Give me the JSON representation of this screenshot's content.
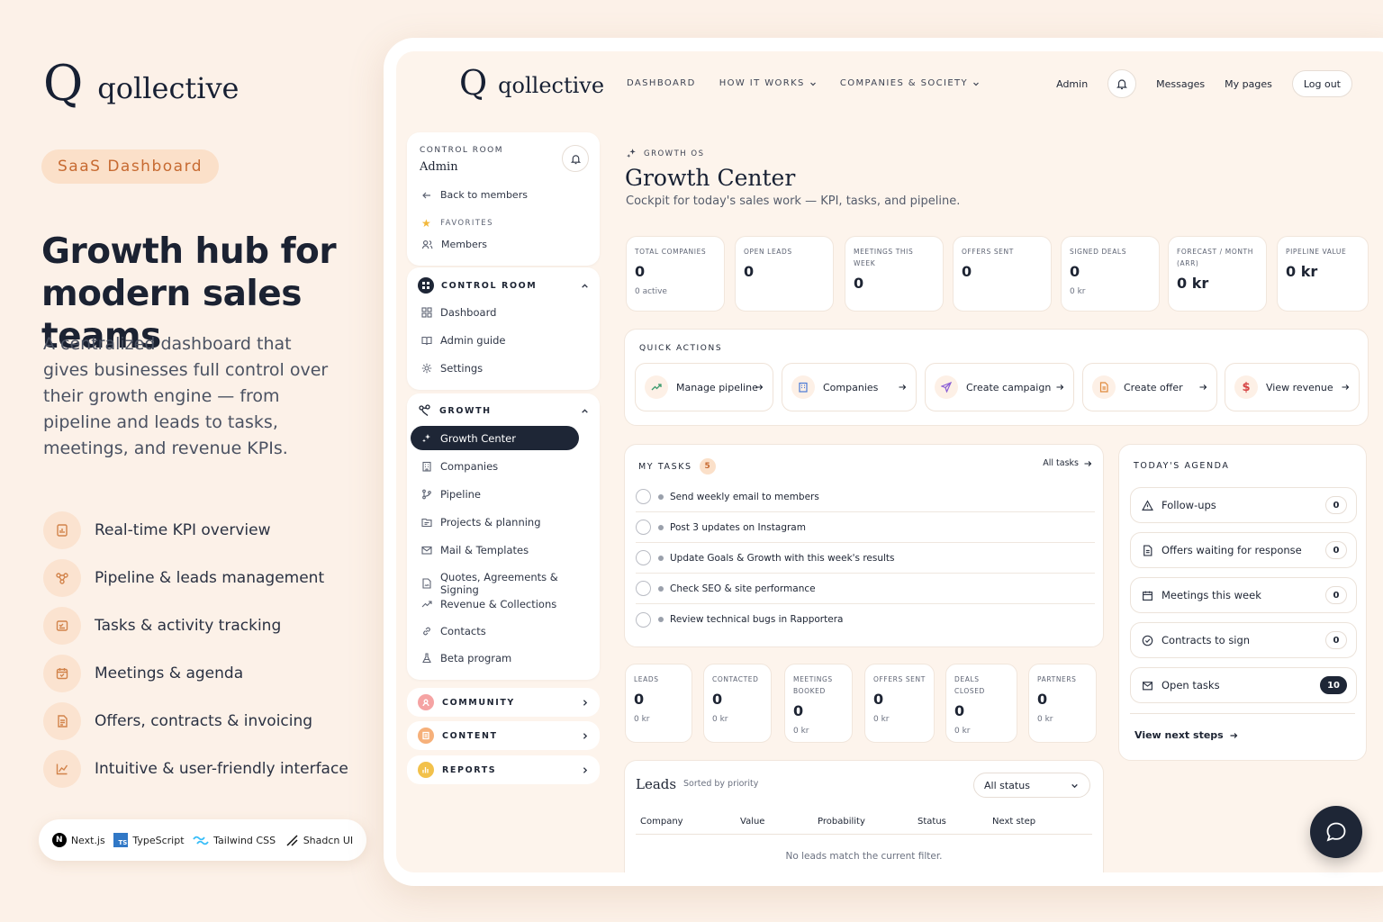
{
  "promo": {
    "brand": "qollective",
    "brand_mark": "Q",
    "badge": "SaaS Dashboard",
    "headline": "Growth hub for modern sales teams",
    "lead": "A centralized dashboard that gives businesses full control over their growth engine — from pipeline and leads to tasks, meetings, and revenue KPIs.",
    "features": [
      {
        "icon": "report-icon",
        "label": "Real-time KPI overview"
      },
      {
        "icon": "pipeline-icon",
        "label": "Pipeline & leads management"
      },
      {
        "icon": "tasks-icon",
        "label": "Tasks & activity tracking"
      },
      {
        "icon": "calendar-icon",
        "label": "Meetings & agenda"
      },
      {
        "icon": "document-icon",
        "label": "Offers, contracts & invoicing"
      },
      {
        "icon": "chart-icon",
        "label": "Intuitive & user-friendly interface"
      }
    ],
    "stack": [
      {
        "icon": "nextjs-icon",
        "label": "Next.js",
        "mark": "N"
      },
      {
        "icon": "typescript-icon",
        "label": "TypeScript",
        "mark": "TS"
      },
      {
        "icon": "tailwind-icon",
        "label": "Tailwind CSS"
      },
      {
        "icon": "shadcn-icon",
        "label": "Shadcn UI"
      }
    ]
  },
  "topnav": {
    "brand": "qollective",
    "brand_mark": "Q",
    "links": [
      "DASHBOARD",
      "HOW IT WORKS",
      "COMPANIES & SOCIETY"
    ],
    "admin": "Admin",
    "messages": "Messages",
    "my_pages": "My pages",
    "logout": "Log out"
  },
  "sidebar": {
    "caption": "CONTROL ROOM",
    "user": "Admin",
    "back": "Back to members",
    "favorites_caption": "FAVORITES",
    "favorites": [
      "Members"
    ],
    "control_room": {
      "title": "CONTROL ROOM",
      "items": [
        "Dashboard",
        "Admin guide",
        "Settings"
      ]
    },
    "growth": {
      "title": "GROWTH",
      "active": "Growth Center",
      "items": [
        "Companies",
        "Pipeline",
        "Projects & planning",
        "Mail & Templates",
        "Quotes, Agreements & Signing",
        "Revenue & Collections",
        "Contacts",
        "Beta program"
      ]
    },
    "collapsed": [
      "COMMUNITY",
      "CONTENT",
      "REPORTS"
    ]
  },
  "main": {
    "eyebrow": "GROWTH OS",
    "title": "Growth Center",
    "subtitle": "Cockpit for today's sales work — KPI, tasks, and pipeline.",
    "kpis": [
      {
        "label": "TOTAL COMPANIES",
        "value": "0",
        "sub": "0 active"
      },
      {
        "label": "OPEN LEADS",
        "value": "0",
        "sub": ""
      },
      {
        "label": "MEETINGS THIS WEEK",
        "value": "0",
        "sub": ""
      },
      {
        "label": "OFFERS SENT",
        "value": "0",
        "sub": ""
      },
      {
        "label": "SIGNED DEALS",
        "value": "0",
        "sub": "0 kr"
      },
      {
        "label": "FORECAST / MONTH (ARR)",
        "value": "0 kr",
        "sub": ""
      },
      {
        "label": "PIPELINE VALUE",
        "value": "0 kr",
        "sub": ""
      }
    ],
    "quick_actions_caption": "QUICK ACTIONS",
    "quick_actions": [
      "Manage pipeline",
      "Companies",
      "Create campaign",
      "Create offer",
      "View revenue"
    ],
    "tasks": {
      "caption": "MY TASKS",
      "count": "5",
      "all_link": "All tasks",
      "items": [
        "Send weekly email to members",
        "Post 3 updates on Instagram",
        "Update Goals & Growth with this week's results",
        "Check SEO & site performance",
        "Review technical bugs in Rapportera"
      ]
    },
    "agenda": {
      "caption": "TODAY'S AGENDA",
      "items": [
        {
          "label": "Follow-ups",
          "count": "0"
        },
        {
          "label": "Offers waiting for response",
          "count": "0"
        },
        {
          "label": "Meetings this week",
          "count": "0"
        },
        {
          "label": "Contracts to sign",
          "count": "0"
        },
        {
          "label": "Open tasks",
          "count": "10"
        }
      ],
      "link": "View next steps"
    },
    "funnel": [
      {
        "label": "LEADS",
        "value": "0",
        "sub": "0 kr"
      },
      {
        "label": "CONTACTED",
        "value": "0",
        "sub": "0 kr"
      },
      {
        "label": "MEETINGS BOOKED",
        "value": "0",
        "sub": "0 kr"
      },
      {
        "label": "OFFERS SENT",
        "value": "0",
        "sub": "0 kr"
      },
      {
        "label": "DEALS CLOSED",
        "value": "0",
        "sub": "0 kr"
      },
      {
        "label": "PARTNERS",
        "value": "0",
        "sub": "0 kr"
      }
    ],
    "leads": {
      "title": "Leads",
      "sort": "Sorted by priority",
      "filter": "All status",
      "columns": [
        "Company",
        "Value",
        "Probability",
        "Status",
        "Next step"
      ],
      "empty": "No leads match the current filter."
    }
  },
  "colors": {
    "accent": "#c76a31",
    "dark": "#1e2636",
    "background": "#fcf1e8"
  }
}
